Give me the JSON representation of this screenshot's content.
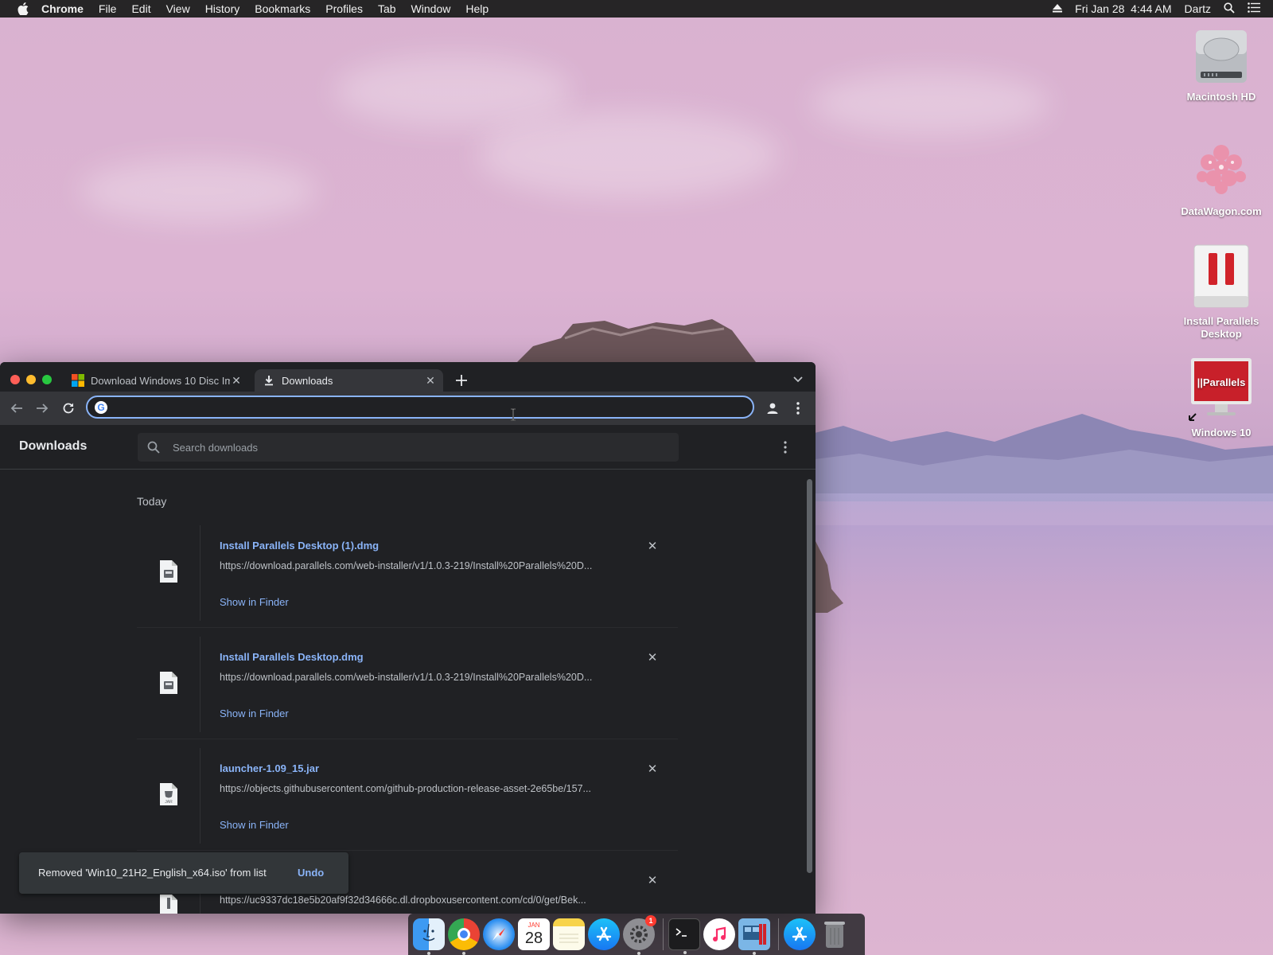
{
  "menubar": {
    "app_name": "Chrome",
    "items": [
      "File",
      "Edit",
      "View",
      "History",
      "Bookmarks",
      "Profiles",
      "Tab",
      "Window",
      "Help"
    ],
    "datetime": "Fri Jan 28  4:44 AM",
    "user": "Dartz"
  },
  "desktop_icons": [
    {
      "label": "Macintosh HD",
      "icon": "hard-drive-icon"
    },
    {
      "label": "DataWagon.com",
      "icon": "flower-image-icon"
    },
    {
      "label": "Install Parallels Desktop",
      "icon": "parallels-installer-icon"
    },
    {
      "label": "Windows 10",
      "icon": "parallels-vm-icon"
    }
  ],
  "browser": {
    "tabs": [
      {
        "title": "Download Windows 10 Disc Im",
        "icon": "microsoft-logo-icon",
        "active": false
      },
      {
        "title": "Downloads",
        "icon": "download-icon",
        "active": true
      }
    ],
    "omnibox": {
      "value": "",
      "placeholder": ""
    }
  },
  "downloads_page": {
    "title": "Downloads",
    "search_placeholder": "Search downloads",
    "section": "Today",
    "items": [
      {
        "name": "Install Parallels Desktop (1).dmg",
        "url": "https://download.parallels.com/web-installer/v1/1.0.3-219/Install%20Parallels%20D...",
        "action": "Show in Finder",
        "file_type": "dmg"
      },
      {
        "name": "Install Parallels Desktop.dmg",
        "url": "https://download.parallels.com/web-installer/v1/1.0.3-219/Install%20Parallels%20D...",
        "action": "Show in Finder",
        "file_type": "dmg"
      },
      {
        "name": "launcher-1.09_15.jar",
        "url": "https://objects.githubusercontent.com/github-production-release-asset-2e65be/157...",
        "action": "Show in Finder",
        "file_type": "jar"
      },
      {
        "name": "",
        "url": "https://uc9337dc18e5b20af9f32d34666c.dl.dropboxusercontent.com/cd/0/get/Bek...",
        "action": "",
        "file_type": "zip"
      }
    ]
  },
  "toast": {
    "message": "Removed 'Win10_21H2_English_x64.iso' from list",
    "action": "Undo"
  },
  "dock": {
    "items": [
      "finder-icon",
      "chrome-icon",
      "safari-icon",
      "calendar-icon",
      "notes-icon",
      "app-store-icon",
      "system-preferences-icon",
      "terminal-icon",
      "itunes-icon",
      "parallels-desktop-icon",
      "app-store-downloads-icon",
      "trash-icon"
    ],
    "calendar_day": "28",
    "calendar_month": "JAN",
    "system_preferences_badge": "1"
  },
  "colors": {
    "accent": "#8ab4f8",
    "window_bg": "#202124",
    "toolbar_bg": "#35363a",
    "menubar_bg": "#262526"
  }
}
